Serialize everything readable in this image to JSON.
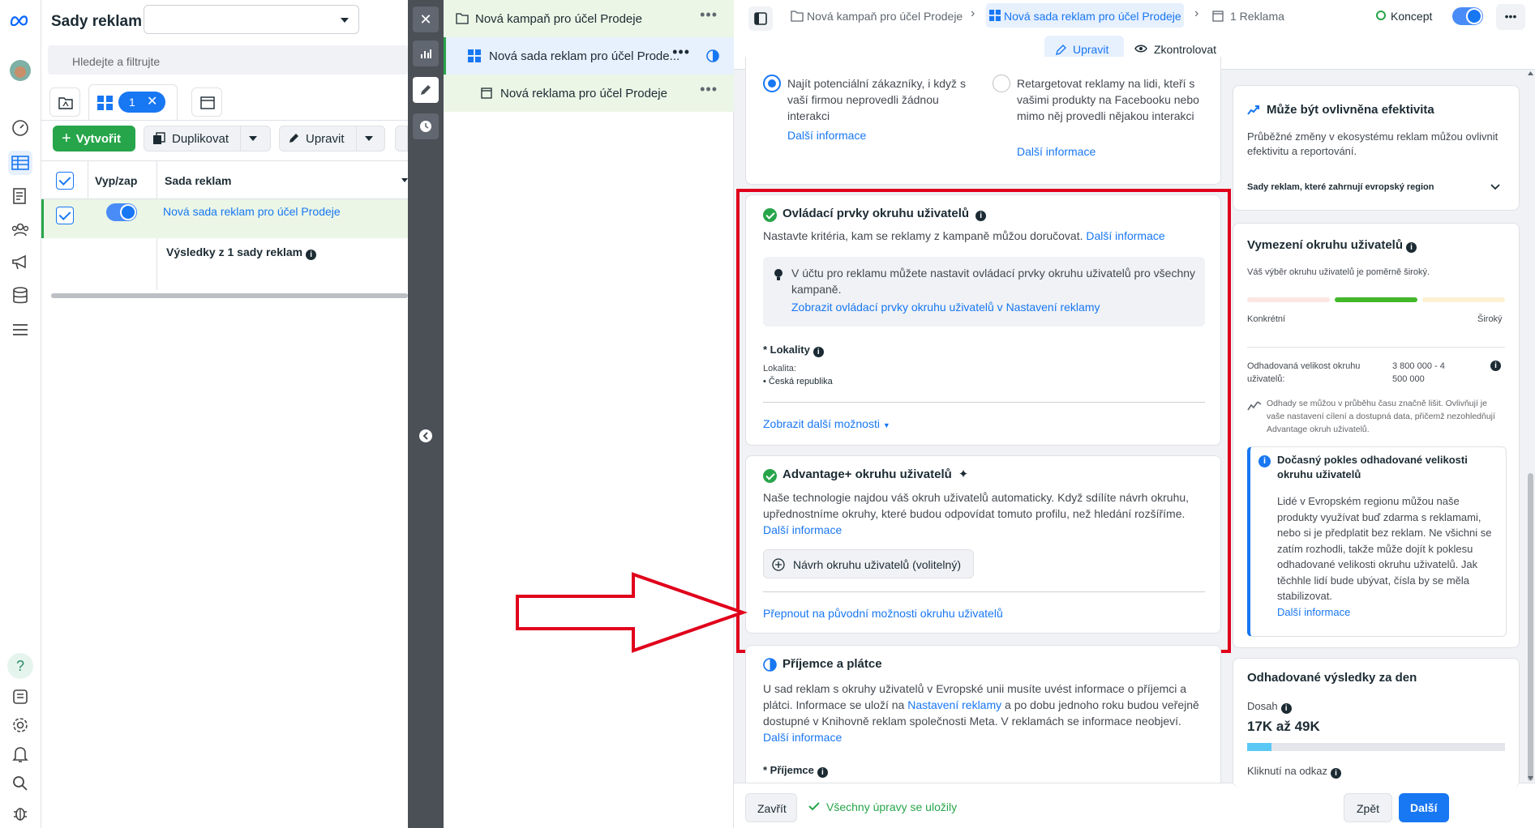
{
  "adsets_panel": {
    "title": "Sady reklam",
    "dropdown_value": "",
    "search_placeholder": "Hledejte a filtrujte",
    "selected_count": "1",
    "create_label": "Vytvořit",
    "duplicate_label": "Duplikovat",
    "edit_label": "Upravit",
    "columns": [
      "Vyp/zap",
      "Sada reklam"
    ],
    "row_name": "Nová sada reklam pro účel Prodeje",
    "results_label": "Výsledky z 1 sady reklam"
  },
  "tree": {
    "campaign": "Nová kampaň pro účel Prodeje",
    "adset": "Nová sada reklam pro účel Prode...",
    "ad": "Nová reklama pro účel Prodeje"
  },
  "topbar": {
    "breadcrumb_campaign": "Nová kampaň pro účel Prodeje",
    "breadcrumb_adset": "Nová sada reklam pro účel Prodeje",
    "breadcrumb_ad": "1 Reklama",
    "status": "Koncept",
    "edit_tab": "Upravit",
    "review_tab": "Zkontrolovat"
  },
  "options": {
    "option1": "Najít potenciální zákazníky, i když s vaší firmou neprovedli žádnou interakci",
    "option1_link": "Další informace",
    "option2": "Retargetovat reklamy na lidi, kteří s vašimi produkty na Facebooku nebo mimo něj provedli nějakou interakci",
    "option2_link": "Další informace"
  },
  "controls": {
    "title": "Ovládací prvky okruhu uživatelů",
    "desc": "Nastavte kritéria, kam se reklamy z kampaně můžou doručovat.",
    "desc_link": "Další informace",
    "tip": "V účtu pro reklamu můžete nastavit ovládací prvky okruhu uživatelů pro všechny kampaně.",
    "tip_link": "Zobrazit ovládací prvky okruhu uživatelů v Nastavení reklamy",
    "locations_label": "* Lokality",
    "location_caption": "Lokalita:",
    "location_value": "Česká republika",
    "more_options": "Zobrazit další možnosti"
  },
  "advantage": {
    "title": "Advantage+ okruhu uživatelů",
    "desc": "Naše technologie najdou váš okruh uživatelů automaticky. Když sdílíte návrh okruhu, upřednostníme okruhy, které budou odpovídat tomuto profilu, než hledání rozšíříme.",
    "desc_link": "Další informace",
    "suggest_button": "Návrh okruhu uživatelů (volitelný)",
    "switch_link": "Přepnout na původní možnosti okruhu uživatelů"
  },
  "payer": {
    "title": "Příjemce a plátce",
    "desc": "U sad reklam s okruhy uživatelů v Evropské unii musíte uvést informace o příjemci a plátci. Informace se uloží na",
    "desc_link1": "Nastavení reklamy",
    "desc_mid": "a po dobu jednoho roku budou veřejně dostupné v Knihovně reklam společnosti Meta. V reklamách se informace neobjeví.",
    "desc_link2": "Další informace",
    "recipient_label": "* Příjemce"
  },
  "right": {
    "perf_title": "Může být ovlivněna efektivita",
    "perf_desc": "Průběžné změny v ekosystému reklam můžou ovlivnit efektivitu a reportování.",
    "perf_region": "Sady reklam, které zahrnují evropský region",
    "audience_title": "Vymezení okruhu uživatelů",
    "audience_desc": "Váš výběr okruhu uživatelů je poměrně široký.",
    "specific": "Konkrétní",
    "broad": "Široký",
    "est_label": "Odhadovaná velikost okruhu uživatelů:",
    "est_value": "3 800 000 - 4 500 000",
    "note": "Odhady se můžou v průběhu času značně lišit. Ovlivňují je vaše nastavení cílení a dostupná data, přičemž nezohledňují Advantage okruh uživatelů.",
    "drop_title": "Dočasný pokles odhadované velikosti okruhu uživatelů",
    "drop_desc": "Lidé v Evropském regionu můžou naše produkty využívat buď zdarma s reklamami, nebo si je předplatit bez reklam. Ne všichni se zatím rozhodli, takže může dojít k poklesu odhadované velikosti okruhu uživatelů. Jak těchhle lidí bude ubývat, čísla by se měla stabilizovat.",
    "drop_link": "Další informace",
    "daily_title": "Odhadované výsledky za den",
    "reach_label": "Dosah",
    "reach_value": "17K až 49K",
    "clicks_label": "Kliknutí na odkaz"
  },
  "footer": {
    "close": "Zavřít",
    "saved": "Všechny úpravy se uložily",
    "back": "Zpět",
    "next": "Další"
  },
  "audience_meter": 0.55,
  "colors": {
    "accent": "#1877f2",
    "success": "#27a54a",
    "highlight": "#e0001b"
  }
}
